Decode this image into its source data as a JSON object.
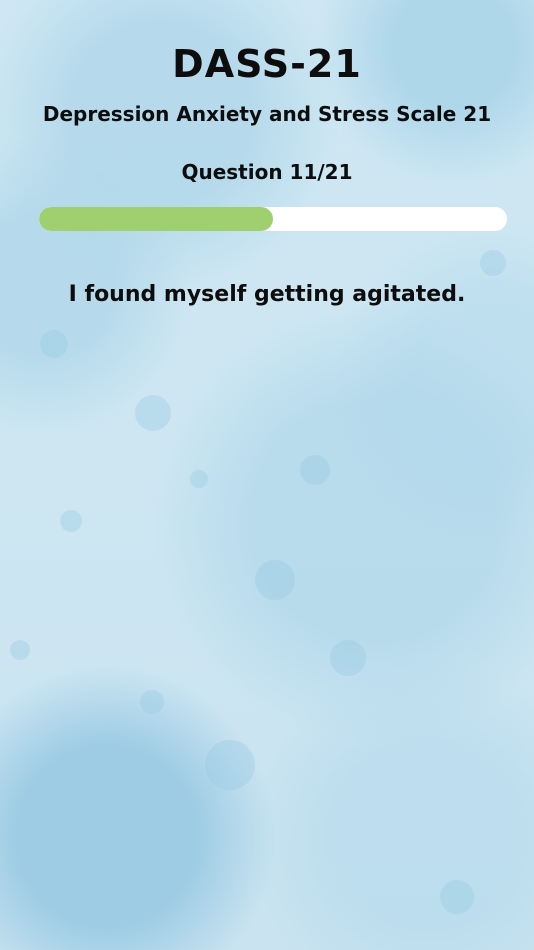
{
  "header": {
    "title": "DASS-21",
    "subtitle": "Depression Anxiety and Stress Scale 21"
  },
  "progress": {
    "label": "Question 11/21",
    "fraction": 0.5
  },
  "question": {
    "text": "I found myself getting agitated."
  },
  "colors": {
    "background": "#cfe6f2",
    "progress_fill": "#9fcf6f",
    "progress_track": "#ffffff",
    "text": "#0d0d0d"
  }
}
